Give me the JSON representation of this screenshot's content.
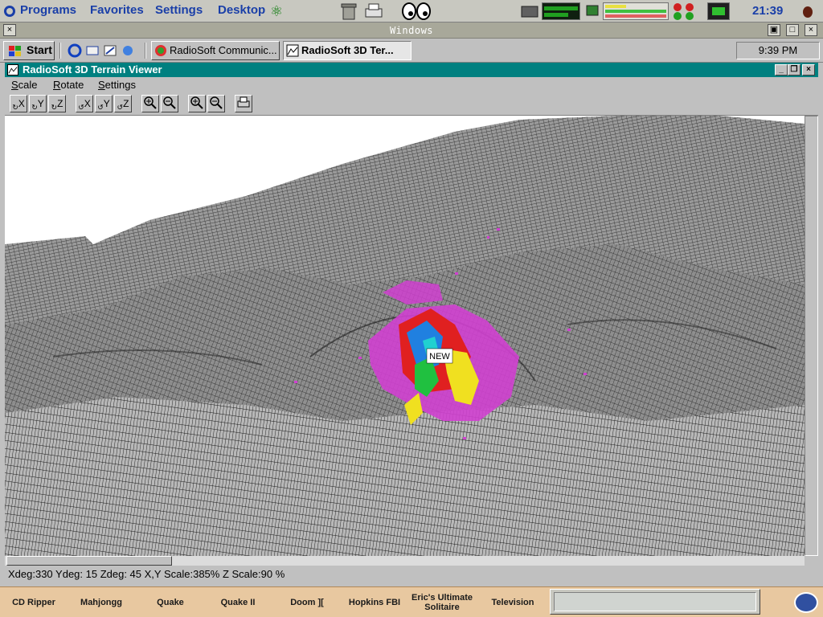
{
  "top_panel": {
    "menus": [
      "Programs",
      "Favorites",
      "Settings",
      "Desktop"
    ],
    "clock": "21:39"
  },
  "window_bar": {
    "title": "Windows"
  },
  "taskbar": {
    "start_label": "Start",
    "tasks": [
      {
        "label": "RadioSoft Communic..."
      },
      {
        "label": "RadioSoft 3D Ter..."
      }
    ],
    "clock": "9:39 PM"
  },
  "app": {
    "title": "RadioSoft 3D Terrain Viewer",
    "menus": [
      {
        "label": "Scale",
        "accel": "S",
        "rest": "cale"
      },
      {
        "label": "Rotate",
        "accel": "R",
        "rest": "otate"
      },
      {
        "label": "Settings",
        "accel": "S",
        "rest": "ettings"
      }
    ],
    "toolbar": {
      "rotate_x": "X",
      "rotate_y": "Y",
      "rotate_z": "Z",
      "rotate_rev_x": "X",
      "rotate_rev_y": "Y",
      "rotate_rev_z": "Z"
    },
    "marker_label": "NEW",
    "status": "Xdeg:330 Ydeg: 15 Zdeg: 45 X,Y Scale:385% Z Scale:90 %"
  },
  "launcher": {
    "items": [
      "CD Ripper",
      "Mahjongg",
      "Quake",
      "Quake II",
      "Doom ][",
      "Hopkins FBI",
      "Eric's Ultimate Solitaire",
      "Television"
    ]
  }
}
